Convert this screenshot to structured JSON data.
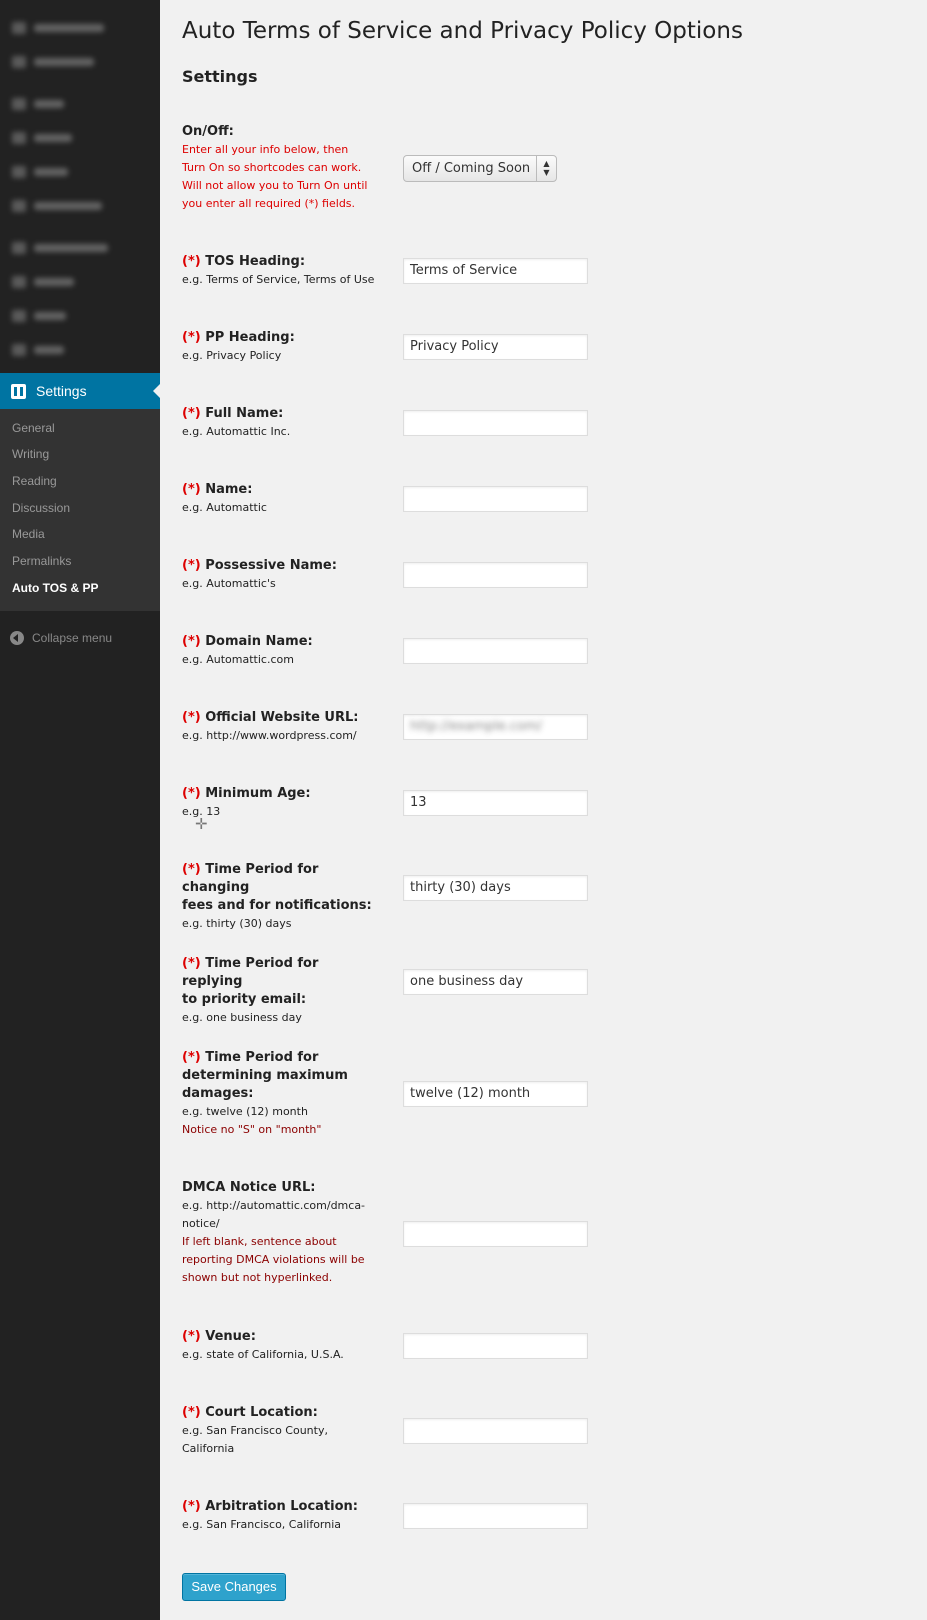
{
  "sidebar": {
    "settings_label": "Settings",
    "submenu": [
      {
        "label": "General"
      },
      {
        "label": "Writing"
      },
      {
        "label": "Reading"
      },
      {
        "label": "Discussion"
      },
      {
        "label": "Media"
      },
      {
        "label": "Permalinks"
      },
      {
        "label": "Auto TOS & PP",
        "current": true
      }
    ],
    "collapse_label": "Collapse menu"
  },
  "page": {
    "title": "Auto Terms of Service and Privacy Policy Options",
    "section": "Settings"
  },
  "required_marker": "(*)",
  "onoff": {
    "label": "On/Off:",
    "help": [
      "Enter all your info below, then",
      "Turn On so shortcodes can work.",
      "Will not allow you to Turn On until",
      "you enter all required (*) fields."
    ],
    "value": "Off / Coming Soon"
  },
  "fields": {
    "tos_heading": {
      "label": "TOS Heading:",
      "example": "e.g. Terms of Service, Terms of Use",
      "value": "Terms of Service"
    },
    "pp_heading": {
      "label": "PP Heading:",
      "example": "e.g. Privacy Policy",
      "value": "Privacy Policy"
    },
    "full_name": {
      "label": "Full Name:",
      "example": "e.g. Automattic Inc.",
      "value": ""
    },
    "name": {
      "label": "Name:",
      "example": "e.g. Automattic",
      "value": ""
    },
    "possessive_name": {
      "label": "Possessive Name:",
      "example": "e.g. Automattic's",
      "value": ""
    },
    "domain_name": {
      "label": "Domain Name:",
      "example": "e.g. Automattic.com",
      "value": ""
    },
    "website_url": {
      "label": "Official Website URL:",
      "example": "e.g. http://www.wordpress.com/",
      "value": "http://example.com/"
    },
    "min_age": {
      "label": "Minimum Age:",
      "example": "e.g. 13",
      "value": "13"
    },
    "fees_period": {
      "label_l1": "Time Period for changing",
      "label_l2": "fees and for notifications:",
      "example": "e.g. thirty (30) days",
      "value": "thirty (30) days"
    },
    "email_period": {
      "label_l1": "Time Period for replying",
      "label_l2": "to priority email:",
      "example": "e.g. one business day",
      "value": "one business day"
    },
    "damages_period": {
      "label_l1": "Time Period for",
      "label_l2": "determining maximum",
      "label_l3": "damages:",
      "example": "e.g. twelve (12) month",
      "note": "Notice no \"S\" on \"month\"",
      "value": "twelve (12) month"
    },
    "dmca_url": {
      "label": "DMCA Notice URL:",
      "example_l1": "e.g. http://automattic.com/dmca-",
      "example_l2": "notice/",
      "note_l1": "If left blank, sentence about",
      "note_l2": "reporting DMCA violations will be",
      "note_l3": "shown but not hyperlinked.",
      "value": ""
    },
    "venue": {
      "label": "Venue:",
      "example": "e.g. state of California, U.S.A.",
      "value": ""
    },
    "court_location": {
      "label": "Court Location:",
      "example_l1": "e.g. San Francisco County,",
      "example_l2": "California",
      "value": ""
    },
    "arbitration_location": {
      "label": "Arbitration Location:",
      "example": "e.g. San Francisco, California",
      "value": ""
    }
  },
  "save_label": "Save Changes",
  "colors": {
    "sidebar_bg": "#222222",
    "accent": "#0074a2",
    "required_red": "#dd0000",
    "button": "#2ea2cc"
  }
}
